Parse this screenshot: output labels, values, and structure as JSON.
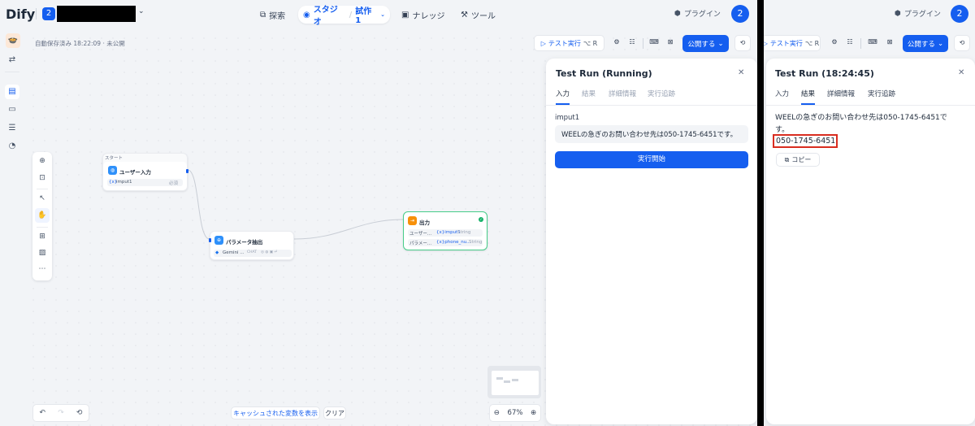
{
  "left": {
    "logo": "Dify",
    "workspace_badge": "2",
    "nav": {
      "explore": "探索",
      "studio": "スタジオ",
      "app": "試作1",
      "knowledge": "ナレッジ",
      "tools": "ツール"
    },
    "plugin": "プラグイン",
    "avatar": "2",
    "autosave": "自動保存済み 18:22:09 · 未公開",
    "toolbar": {
      "test_run": "テスト実行",
      "shortcut": "⌥ R",
      "publish": "公開する"
    },
    "nodes": {
      "start": {
        "group": "スタート",
        "title": "ユーザー入力",
        "var": "imput1",
        "required": "必須"
      },
      "param": {
        "title": "パラメータ抽出",
        "model": "Gemini ...",
        "mode": "CHAT"
      },
      "output": {
        "title": "出力",
        "row1_label": "ユーザー...",
        "row1_var": "{x}imput1",
        "row1_type": "String",
        "row2_label": "パラメー...",
        "row2_var": "{x}phone_nu...",
        "row2_type": "String"
      }
    },
    "panel": {
      "title": "Test Run (Running)",
      "tabs": [
        "入力",
        "結果",
        "詳細情報",
        "実行追跡"
      ],
      "field_label": "imput1",
      "field_value": "WEELの急ぎのお問い合わせ先は050-1745-6451です。",
      "run_button": "実行開始"
    },
    "bottom": {
      "cache_vars": "キャッシュされた変数を表示",
      "clear": "クリア",
      "zoom": "67%"
    }
  },
  "right": {
    "plugin": "プラグイン",
    "avatar": "2",
    "toolbar": {
      "test_run": "テスト実行",
      "shortcut": "⌥ R",
      "publish": "公開する"
    },
    "panel": {
      "title": "Test Run (18:24:45)",
      "tabs": [
        "入力",
        "結果",
        "詳細情報",
        "実行追跡"
      ],
      "result_line1": "WEELの急ぎのお問い合わせ先は050-1745-6451で",
      "result_line2": "す。",
      "highlight": "050-1745-6451",
      "copy": "コピー"
    }
  },
  "colors": {
    "accent": "#155eef",
    "highlight_border": "#d92d20",
    "success": "#17b26a"
  }
}
